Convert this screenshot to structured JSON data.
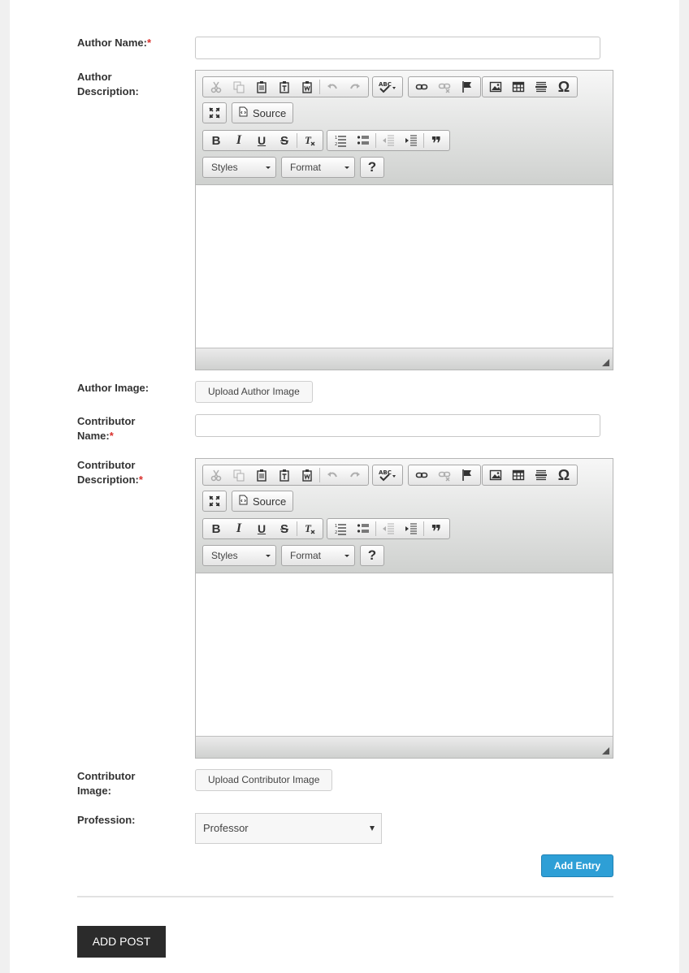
{
  "author": {
    "name_label": "Author Name:",
    "name_required": "*",
    "name_value": "",
    "description_label_line1": "Author",
    "description_label_line2": "Description:",
    "image_label": "Author Image:",
    "upload_button": "Upload Author Image"
  },
  "contributor": {
    "name_label_line1": "Contributor",
    "name_label_line2": "Name:",
    "name_required": "*",
    "name_value": "",
    "description_label_line1": "Contributor",
    "description_label_line2": "Description:",
    "description_required": "*",
    "image_label_line1": "Contributor",
    "image_label_line2": "Image:",
    "upload_button": "Upload Contributor Image"
  },
  "editor": {
    "source_label": "Source",
    "styles_label": "Styles",
    "format_label": "Format",
    "help_label": "?",
    "bold_label": "B",
    "italic_label": "I",
    "underline_label": "U",
    "strike_label": "S",
    "omega_label": "Ω",
    "quote_label": "❞"
  },
  "profession": {
    "label": "Profession:",
    "selected": "Professor"
  },
  "actions": {
    "add_entry": "Add Entry",
    "add_post": "ADD POST"
  },
  "colors": {
    "accent": "#2e9fd6",
    "required": "#d9302c",
    "dark_button": "#2b2b2b"
  }
}
